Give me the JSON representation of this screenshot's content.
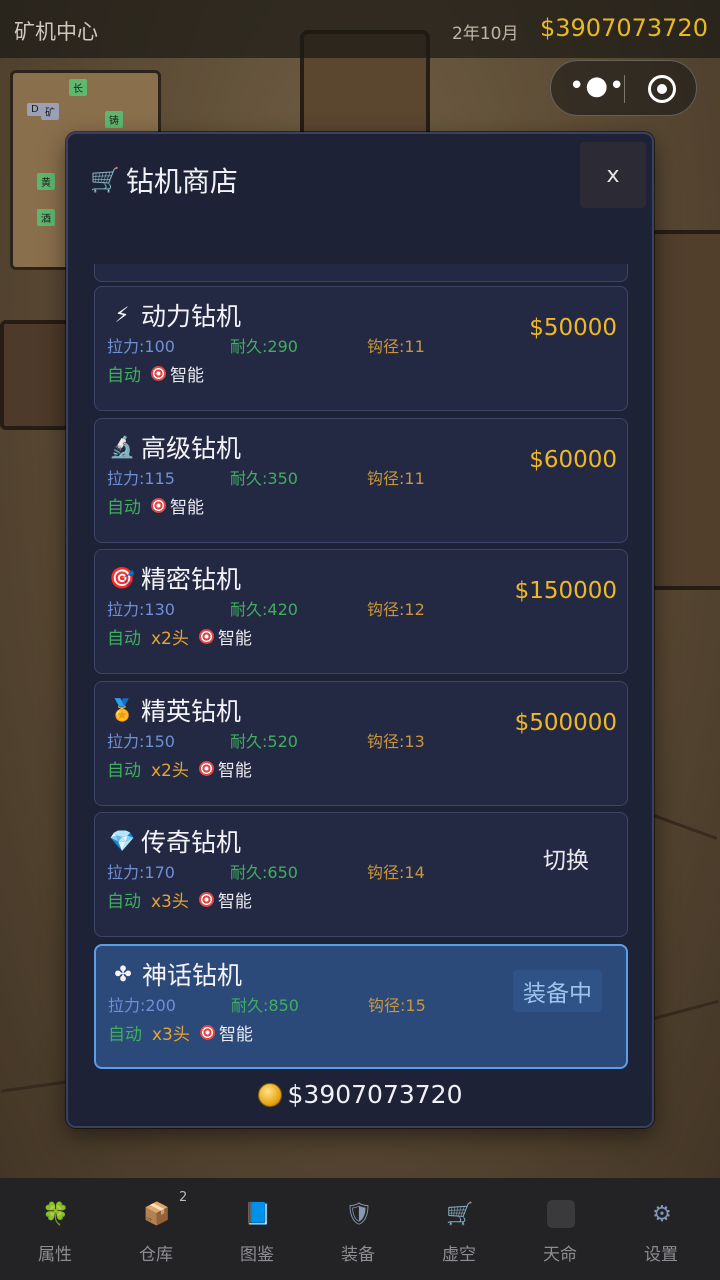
{
  "topbar": {
    "title": "矿机中心",
    "date": "2年10月",
    "money": "$3907073720"
  },
  "capsule": {
    "more_icon": "more-dots-icon",
    "close_icon": "target-circle-icon"
  },
  "minimap": {
    "tags": [
      "长",
      "D",
      "矿",
      "铸",
      "黄",
      "酒"
    ]
  },
  "modal": {
    "title": "钻机商店",
    "title_icon": "shopping-cart-icon",
    "close_label": "x",
    "balance": "$3907073720",
    "balance_icon": "coin-stack-icon"
  },
  "drills": [
    {
      "icon": "lightning-icon",
      "icon_glyph": "⚡",
      "name": "动力钻机",
      "pull": "拉力:100",
      "durability": "耐久:290",
      "hook": "钩径:11",
      "auto": "自动",
      "heads": "",
      "smart": "智能",
      "price": "$50000",
      "action": "",
      "equipped": false
    },
    {
      "icon": "microscope-icon",
      "icon_glyph": "🔬",
      "name": "高级钻机",
      "pull": "拉力:115",
      "durability": "耐久:350",
      "hook": "钩径:11",
      "auto": "自动",
      "heads": "",
      "smart": "智能",
      "price": "$60000",
      "action": "",
      "equipped": false
    },
    {
      "icon": "target-icon",
      "icon_glyph": "🎯",
      "name": "精密钻机",
      "pull": "拉力:130",
      "durability": "耐久:420",
      "hook": "钩径:12",
      "auto": "自动",
      "heads": "x2头",
      "smart": "智能",
      "price": "$150000",
      "action": "",
      "equipped": false
    },
    {
      "icon": "medal-icon",
      "icon_glyph": "🏅",
      "name": "精英钻机",
      "pull": "拉力:150",
      "durability": "耐久:520",
      "hook": "钩径:13",
      "auto": "自动",
      "heads": "x2头",
      "smart": "智能",
      "price": "$500000",
      "action": "",
      "equipped": false
    },
    {
      "icon": "gem-icon",
      "icon_glyph": "💎",
      "name": "传奇钻机",
      "pull": "拉力:170",
      "durability": "耐久:650",
      "hook": "钩径:14",
      "auto": "自动",
      "heads": "x3头",
      "smart": "智能",
      "price": "",
      "action": "切换",
      "equipped": false
    },
    {
      "icon": "sparkle-cross-icon",
      "icon_glyph": "✤",
      "name": "神话钻机",
      "pull": "拉力:200",
      "durability": "耐久:850",
      "hook": "钩径:15",
      "auto": "自动",
      "heads": "x3头",
      "smart": "智能",
      "price": "",
      "action": "装备中",
      "equipped": true
    }
  ],
  "bottom_nav": [
    {
      "label": "属性",
      "icon": "clover-icon",
      "glyph": "🍀",
      "badge": ""
    },
    {
      "label": "仓库",
      "icon": "box-icon",
      "glyph": "📦",
      "badge": "2"
    },
    {
      "label": "图鉴",
      "icon": "book-icon",
      "glyph": "📘",
      "badge": ""
    },
    {
      "label": "装备",
      "icon": "shield-icon",
      "glyph": "🛡",
      "badge": ""
    },
    {
      "label": "虚空",
      "icon": "cart-icon",
      "glyph": "🛒",
      "badge": ""
    },
    {
      "label": "天命",
      "icon": "blank-square-icon",
      "glyph": "",
      "badge": ""
    },
    {
      "label": "设置",
      "icon": "gear-icon",
      "glyph": "⚙",
      "badge": ""
    }
  ],
  "colors": {
    "money": "#e8b923",
    "price": "#f0b824",
    "pull": "#6f8fd6",
    "durability": "#3fae5f",
    "hook": "#c9963d",
    "equipped_border": "#5c9ee6"
  }
}
